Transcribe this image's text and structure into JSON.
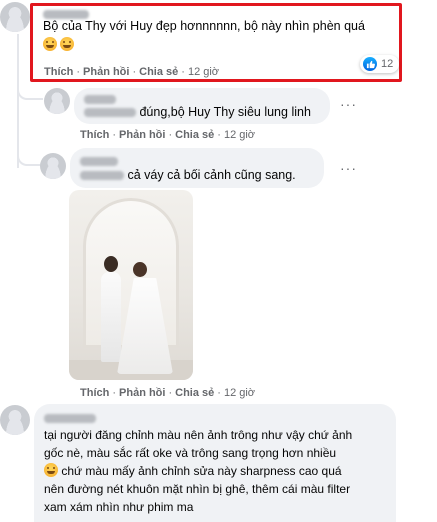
{
  "comments": [
    {
      "text": "Bộ của Thy với Huy đẹp hơnnnnnn, bộ này nhìn phèn quá",
      "emojis": [
        "laughing-crying-emoji",
        "laughing-crying-emoji"
      ],
      "actions": {
        "like": "Thích",
        "reply": "Phản hồi",
        "share": "Chia sẻ",
        "time": "12 giờ"
      },
      "reaction_count": "12",
      "highlighted": true
    },
    {
      "text": "đúng,bộ Huy Thy siêu lung linh",
      "actions": {
        "like": "Thích",
        "reply": "Phản hồi",
        "share": "Chia sẻ",
        "time": "12 giờ"
      }
    },
    {
      "text": "cả váy cả bối cảnh cũng sang.",
      "actions": {
        "like": "Thích",
        "reply": "Phản hồi",
        "share": "Chia sẻ",
        "time": "12 giờ"
      },
      "has_photo": true
    },
    {
      "text_lines": [
        "tại người đăng chỉnh màu nên ảnh trông như vậy chứ ảnh",
        "gốc nè, màu sắc rất oke và trông sang trọng hơn nhiều",
        "chứ màu mấy ảnh chỉnh sửa này sharpness cao quá",
        "nên đường nét khuôn mặt nhìn bị ghê, thêm cái màu filter",
        "xam xám nhìn như phim ma"
      ]
    }
  ],
  "colors": {
    "highlight_border": "#e1171e",
    "bubble_bg": "#f0f2f5",
    "meta_text": "#65676b",
    "like_blue": "#0062df"
  }
}
